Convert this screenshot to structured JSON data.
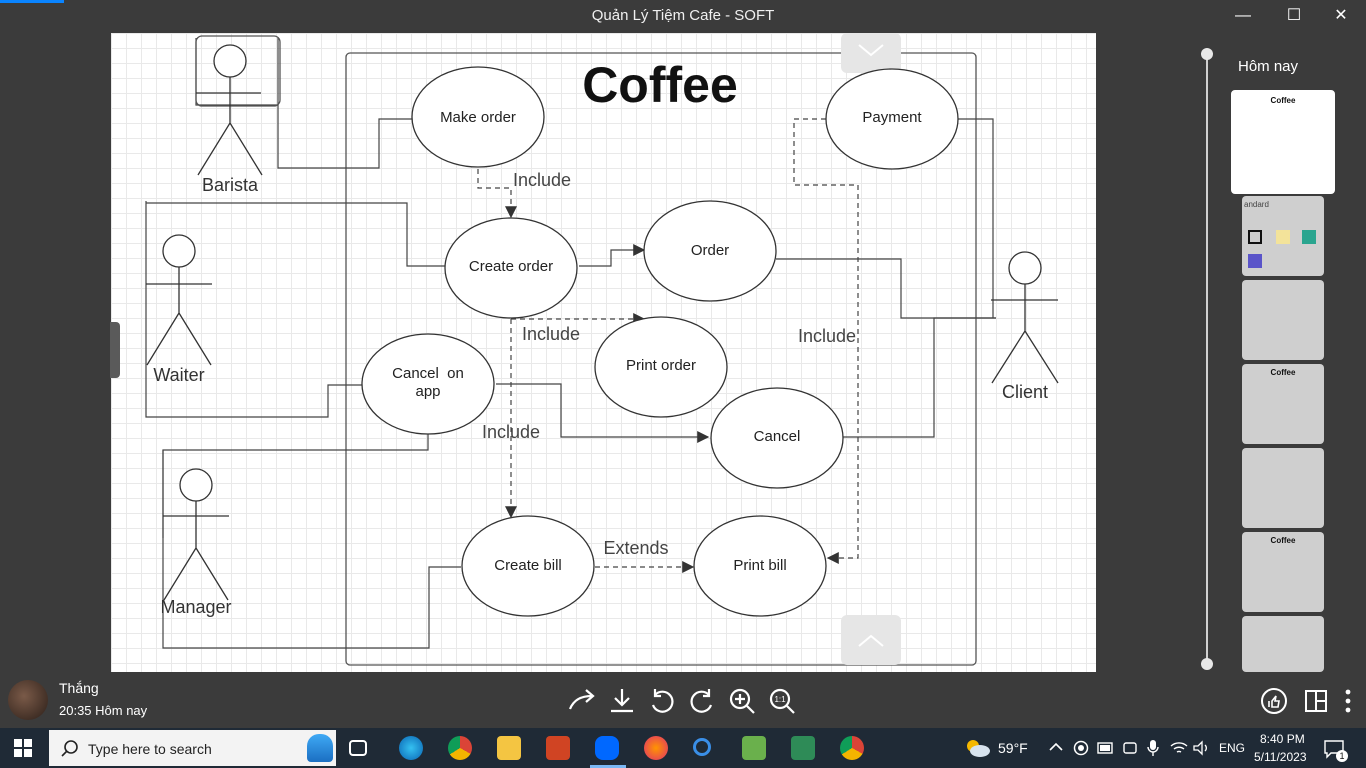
{
  "window": {
    "title": "Quản Lý Tiệm Cafe - SOFT",
    "minimize_glyph": "—",
    "maximize_glyph": "☐",
    "close_glyph": "✕"
  },
  "diagram": {
    "title": "Coffee",
    "actors": [
      "Barista",
      "Waiter",
      "Client",
      "Manager"
    ],
    "use_cases": [
      "Make order",
      "Payment",
      "Create order",
      "Order",
      "Print order",
      "Cancel  on app",
      "Cancel",
      "Create bill",
      "Print bill"
    ],
    "relations": [
      "Include",
      "Include",
      "Include",
      "Include",
      "Extends"
    ]
  },
  "sidebar": {
    "label": "Hôm nay",
    "thumbs": [
      "Coffee",
      "andard",
      "",
      "Coffee",
      "",
      "Coffee",
      ""
    ]
  },
  "footer": {
    "user_name": "Thắng",
    "time": "20:35 Hôm nay",
    "tools": [
      "share-icon",
      "download-icon",
      "rotate-left-icon",
      "rotate-right-icon",
      "zoom-in-icon",
      "actual-size-icon"
    ],
    "actual_size_label": "1:1"
  },
  "taskbar": {
    "search_placeholder": "Type here to search",
    "weather": "59°F",
    "lang": "ENG",
    "clock_time": "8:40 PM",
    "clock_date": "5/11/2023",
    "notification_count": "1"
  }
}
